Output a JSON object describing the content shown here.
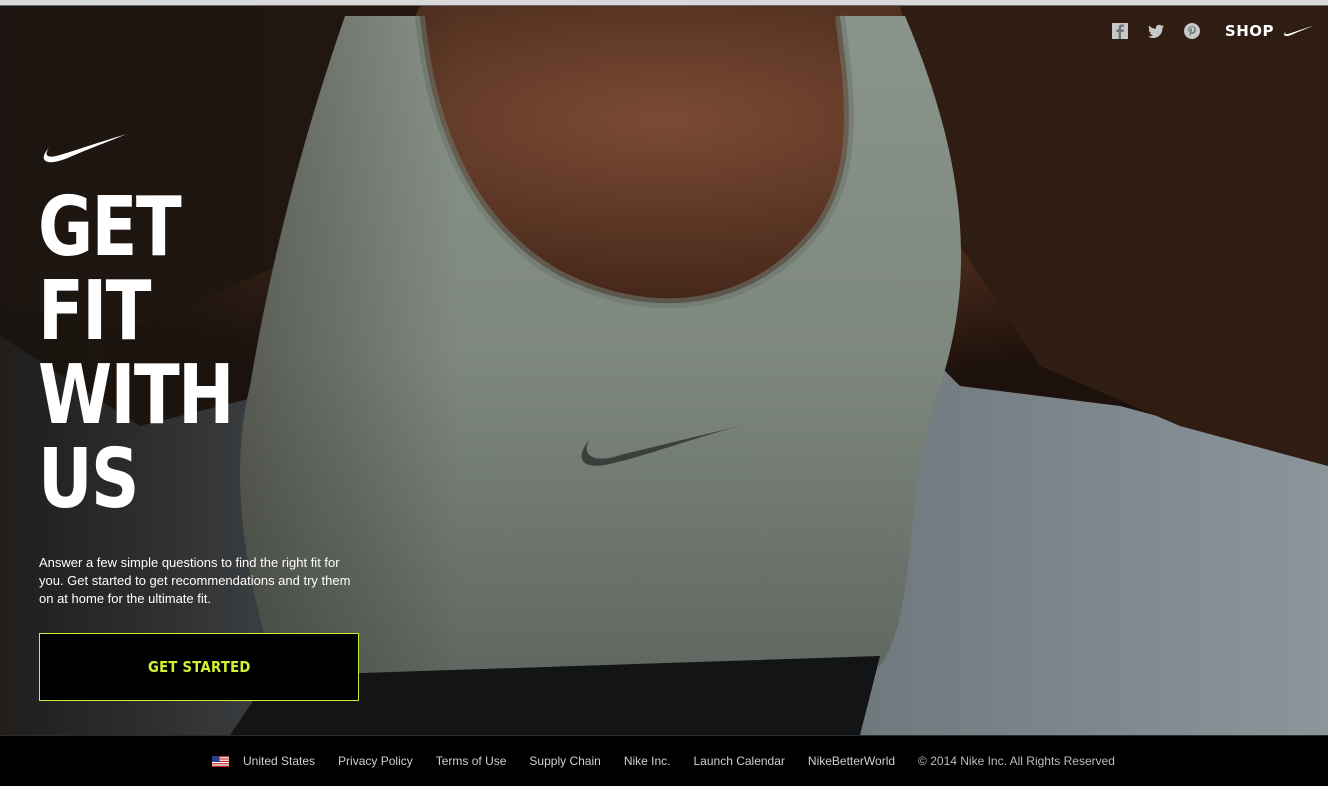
{
  "nav": {
    "icons": [
      "facebook-icon",
      "twitter-icon",
      "pinterest-icon"
    ],
    "shop_label": "SHOP",
    "shop_icon": "nike-swoosh-icon"
  },
  "hero": {
    "logo_icon": "nike-swoosh-icon",
    "headline": [
      "GET",
      "FIT",
      "WITH",
      "US"
    ],
    "intro": "Answer a few simple questions to find the right fit for you. Get started to get recommendations and try them on at home for the ultimate fit.",
    "cta_label": "GET STARTED",
    "image_description_icon": "sports-bra-photo"
  },
  "footer": {
    "flag_icon": "us-flag-icon",
    "links": [
      "United States",
      "Privacy Policy",
      "Terms of Use",
      "Supply Chain",
      "Nike Inc.",
      "Launch Calendar",
      "NikeBetterWorld"
    ],
    "copyright": "© 2014 Nike Inc. All Rights Reserved"
  },
  "colors": {
    "accent": "#d4f22e",
    "footer_bg": "#000000",
    "text": "#ffffff"
  }
}
